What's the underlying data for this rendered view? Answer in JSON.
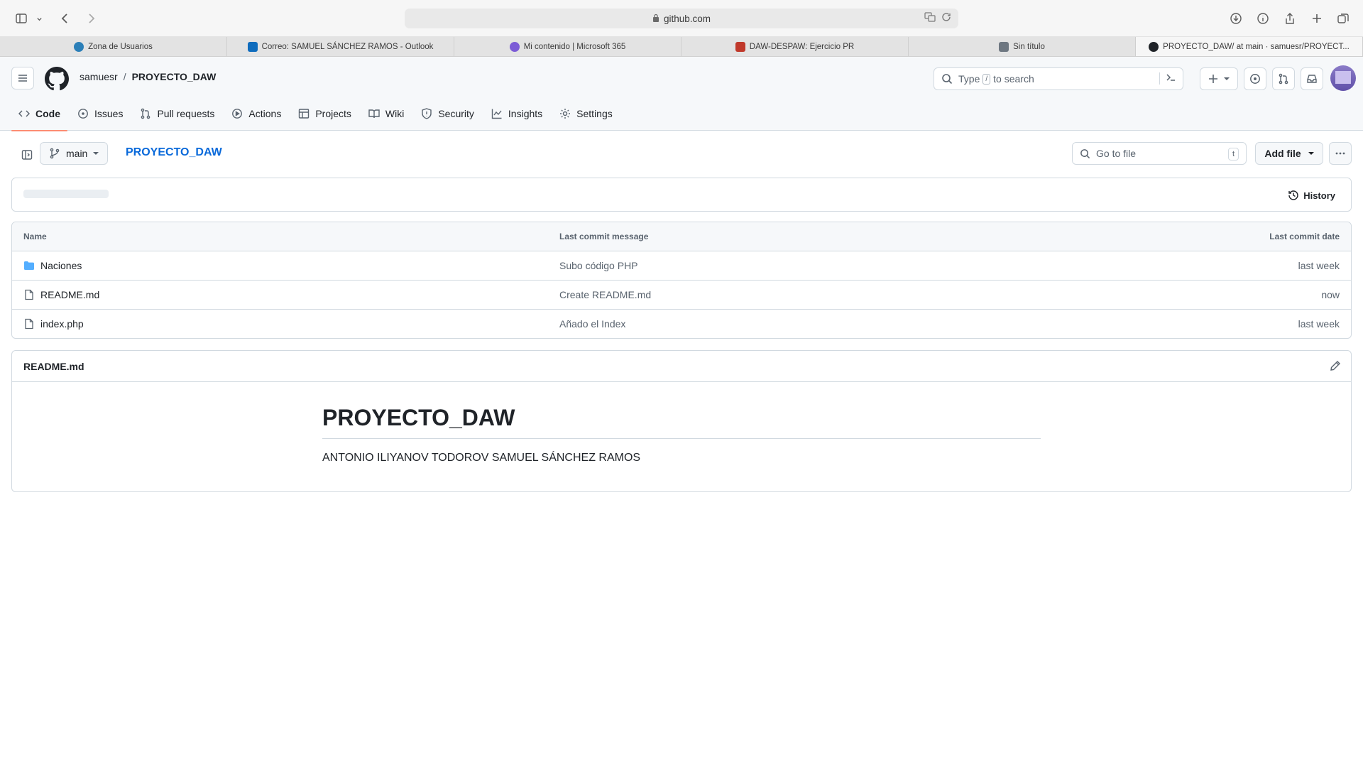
{
  "browser": {
    "url": "github.com",
    "tabs": [
      {
        "label": "Zona de Usuarios",
        "color": "#2b7fb8"
      },
      {
        "label": "Correo: SAMUEL SÁNCHEZ RAMOS - Outlook",
        "color": "#0f6cbd"
      },
      {
        "label": "Mi contenido | Microsoft 365",
        "color": "#7b5bd6"
      },
      {
        "label": "DAW-DESPAW: Ejercicio PR",
        "color": "#c0392b"
      },
      {
        "label": "Sin título",
        "color": "#6e7781"
      },
      {
        "label": "PROYECTO_DAW/ at main · samuesr/PROYECT...",
        "color": "#1f2328"
      }
    ]
  },
  "header": {
    "owner": "samuesr",
    "separator": "/",
    "repo": "PROYECTO_DAW",
    "search_placeholder_pre": "Type",
    "search_key": "/",
    "search_placeholder_post": "to search"
  },
  "repo_nav": {
    "code": "Code",
    "issues": "Issues",
    "pulls": "Pull requests",
    "actions": "Actions",
    "projects": "Projects",
    "wiki": "Wiki",
    "security": "Security",
    "insights": "Insights",
    "settings": "Settings"
  },
  "toolbar": {
    "branch": "main",
    "repo_link": "PROYECTO_DAW",
    "goto_placeholder": "Go to file",
    "goto_key": "t",
    "add_file": "Add file",
    "history": "History"
  },
  "table": {
    "headers": {
      "name": "Name",
      "message": "Last commit message",
      "date": "Last commit date"
    },
    "rows": [
      {
        "name": "Naciones",
        "type": "folder",
        "message": "Subo código PHP",
        "date": "last week"
      },
      {
        "name": "README.md",
        "type": "file",
        "message": "Create README.md",
        "date": "now"
      },
      {
        "name": "index.php",
        "type": "file",
        "message": "Añado el Index",
        "date": "last week"
      }
    ]
  },
  "readme": {
    "filename": "README.md",
    "title": "PROYECTO_DAW",
    "body": "ANTONIO ILIYANOV TODOROV SAMUEL SÁNCHEZ RAMOS"
  },
  "colors": {
    "accent": "#0969da",
    "tab_underline": "#fd8c73",
    "folder": "#54aeff"
  }
}
